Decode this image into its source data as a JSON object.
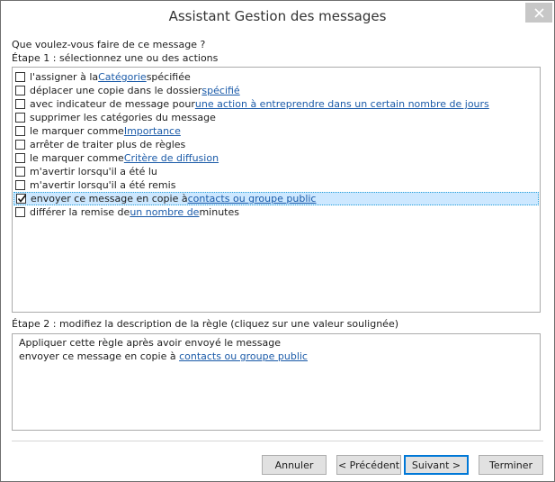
{
  "window": {
    "title": "Assistant Gestion des messages"
  },
  "question": "Que voulez-vous faire de ce message ?",
  "step1_label": "Étape 1 : sélectionnez une ou des actions",
  "actions": [
    {
      "checked": false,
      "pre": "l'assigner à la ",
      "link": "Catégorie",
      "post": " spécifiée"
    },
    {
      "checked": false,
      "pre": "déplacer une copie dans le dossier ",
      "link": "spécifié",
      "post": ""
    },
    {
      "checked": false,
      "pre": "avec indicateur de message pour ",
      "link": "une action à entreprendre dans un certain nombre de jours",
      "post": ""
    },
    {
      "checked": false,
      "pre": "supprimer les catégories du message",
      "link": "",
      "post": ""
    },
    {
      "checked": false,
      "pre": "le marquer comme ",
      "link": "Importance",
      "post": ""
    },
    {
      "checked": false,
      "pre": "arrêter de traiter plus de règles",
      "link": "",
      "post": ""
    },
    {
      "checked": false,
      "pre": "le marquer comme ",
      "link": "Critère de diffusion",
      "post": ""
    },
    {
      "checked": false,
      "pre": "m'avertir lorsqu'il a été lu",
      "link": "",
      "post": ""
    },
    {
      "checked": false,
      "pre": "m'avertir lorsqu'il a été remis",
      "link": "",
      "post": ""
    },
    {
      "checked": true,
      "pre": "envoyer ce message en copie à ",
      "link": "contacts ou groupe public",
      "post": ""
    },
    {
      "checked": false,
      "pre": "différer la remise de ",
      "link": "un nombre de",
      "post": " minutes"
    }
  ],
  "step2_label": "Étape 2 : modifiez la description de la règle (cliquez sur une valeur soulignée)",
  "description": {
    "line1": "Appliquer cette règle après avoir envoyé le message",
    "line2_pre": "envoyer ce message en copie à ",
    "line2_link": "contacts ou groupe public"
  },
  "buttons": {
    "cancel": "Annuler",
    "back": "< Précédent",
    "next": "Suivant >",
    "finish": "Terminer"
  },
  "colors": {
    "link": "#1a5aa8",
    "selection": "#cde8ff",
    "default_button_border": "#0078d7"
  }
}
